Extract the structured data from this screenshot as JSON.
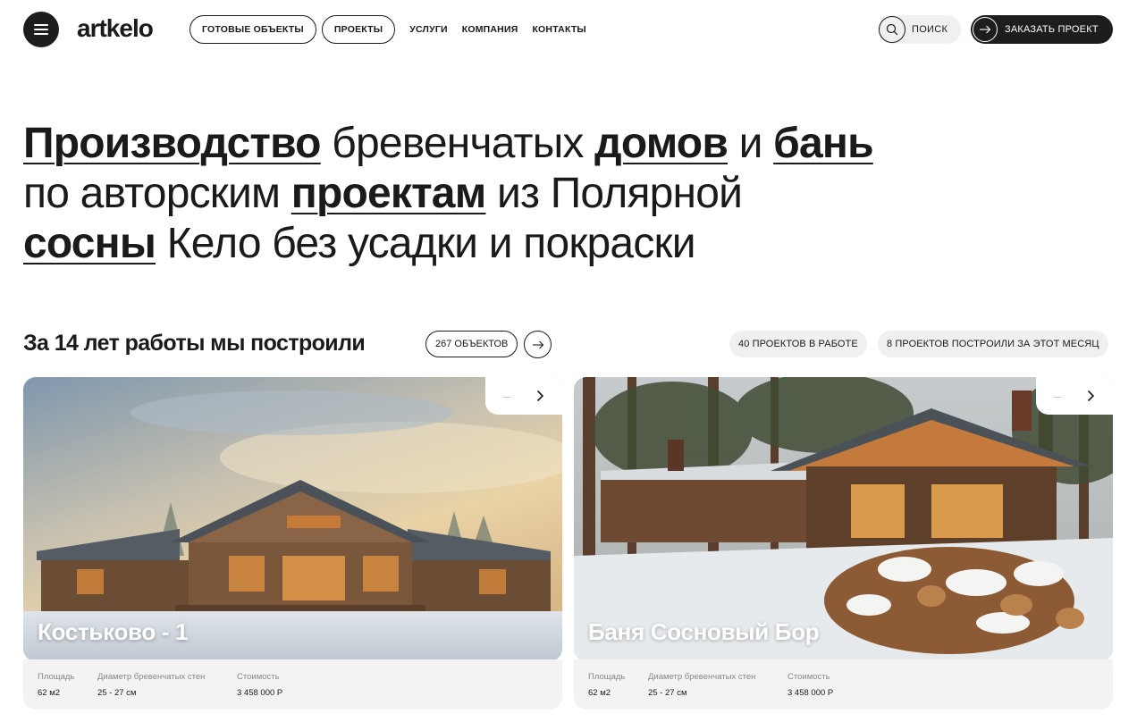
{
  "header": {
    "logo": "artkelo",
    "nav_pills": [
      "ГОТОВЫЕ ОБЪЕКТЫ",
      "ПРОЕКТЫ"
    ],
    "nav_links": [
      "УСЛУГИ",
      "КОМПАНИЯ",
      "КОНТАКТЫ"
    ],
    "search_label": "ПОИСК",
    "order_label": "ЗАКАЗАТЬ ПРОЕКТ"
  },
  "hero": {
    "w1": "Производство",
    "t1": " бревенчатых ",
    "w2": "домов",
    "t2": " и ",
    "w3": "бань",
    "t3": "по авторским ",
    "w4": "проектам",
    "t4": " из Полярной",
    "w5": "сосны",
    "t5": " Кело без усадки и покраски"
  },
  "stats": {
    "heading": "За 14 лет работы мы построили",
    "count": "267 ОБЪЕКТОВ",
    "tag_in_work": "40 ПРОЕКТОВ В РАБОТЕ",
    "tag_month": "8 ПРОЕКТОВ ПОСТРОИЛИ ЗА ЭТОТ МЕСЯЦ"
  },
  "cards": [
    {
      "title": "Костьково - 1",
      "area_label": "Площадь",
      "area": "62 м2",
      "diam_label": "Диаметр бревенчатых стен",
      "diam": "25 - 27 см",
      "price_label": "Стоимость",
      "price": "3 458 000 Р"
    },
    {
      "title": "Баня Сосновый Бор",
      "area_label": "Площадь",
      "area": "62 м2",
      "diam_label": "Диаметр бревенчатых стен",
      "diam": "25 - 27 см",
      "price_label": "Стоимость",
      "price": "3 458 000 Р"
    }
  ],
  "slider": {
    "prev": "–",
    "next": "›"
  }
}
